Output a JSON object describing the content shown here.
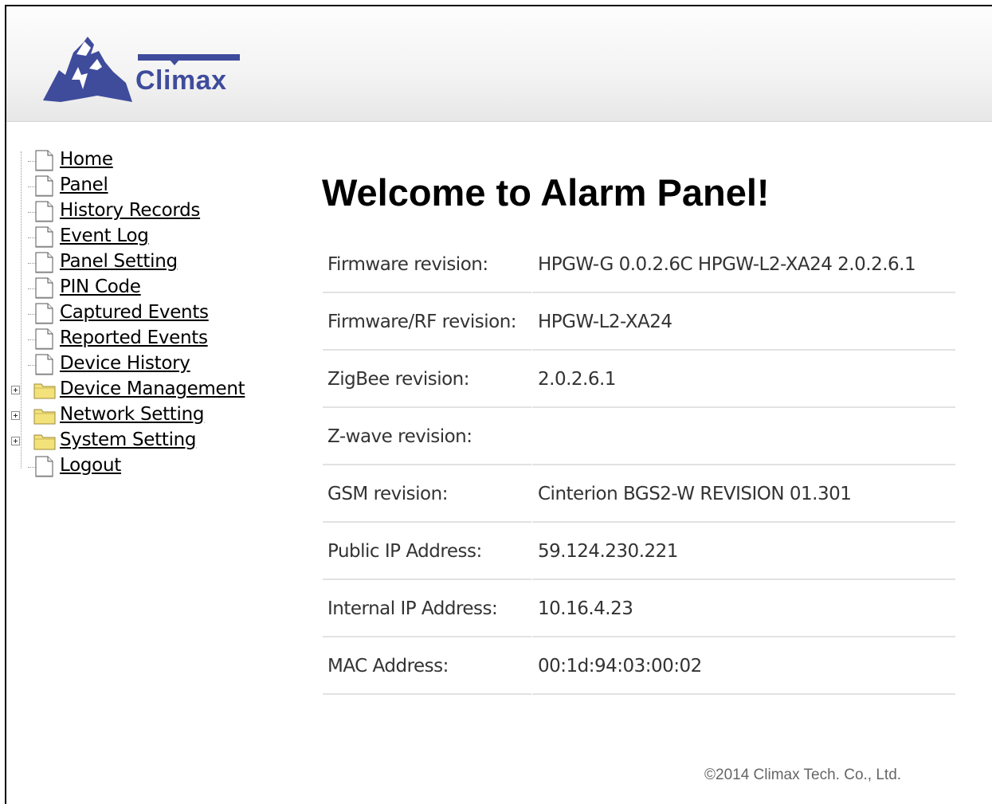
{
  "logo": {
    "text": "Climax"
  },
  "nav": {
    "items": [
      {
        "label": "Home",
        "type": "page"
      },
      {
        "label": "Panel",
        "type": "page"
      },
      {
        "label": "History Records",
        "type": "page"
      },
      {
        "label": "Event Log",
        "type": "page"
      },
      {
        "label": "Panel Setting",
        "type": "page"
      },
      {
        "label": "PIN Code",
        "type": "page"
      },
      {
        "label": "Captured Events",
        "type": "page"
      },
      {
        "label": "Reported Events",
        "type": "page"
      },
      {
        "label": "Device History",
        "type": "page"
      },
      {
        "label": "Device Management",
        "type": "folder"
      },
      {
        "label": "Network Setting",
        "type": "folder"
      },
      {
        "label": "System Setting",
        "type": "folder"
      },
      {
        "label": "Logout",
        "type": "page"
      }
    ]
  },
  "main": {
    "title": "Welcome to Alarm Panel!",
    "rows": [
      {
        "label": "Firmware revision:",
        "value": "HPGW-G 0.0.2.6C HPGW-L2-XA24 2.0.2.6.1"
      },
      {
        "label": "Firmware/RF revision:",
        "value": "HPGW-L2-XA24"
      },
      {
        "label": "ZigBee revision:",
        "value": "2.0.2.6.1"
      },
      {
        "label": "Z-wave revision:",
        "value": ""
      },
      {
        "label": "GSM revision:",
        "value": "Cinterion BGS2-W REVISION 01.301"
      },
      {
        "label": "Public IP Address:",
        "value": "59.124.230.221"
      },
      {
        "label": "Internal IP Address:",
        "value": "10.16.4.23"
      },
      {
        "label": "MAC Address:",
        "value": "00:1d:94:03:00:02"
      }
    ]
  },
  "footer": {
    "copyright": "©2014 Climax Tech. Co., Ltd."
  },
  "colors": {
    "brand": "#3f4c9c",
    "folder": "#f3e27a",
    "divider": "#e2e2e2"
  }
}
